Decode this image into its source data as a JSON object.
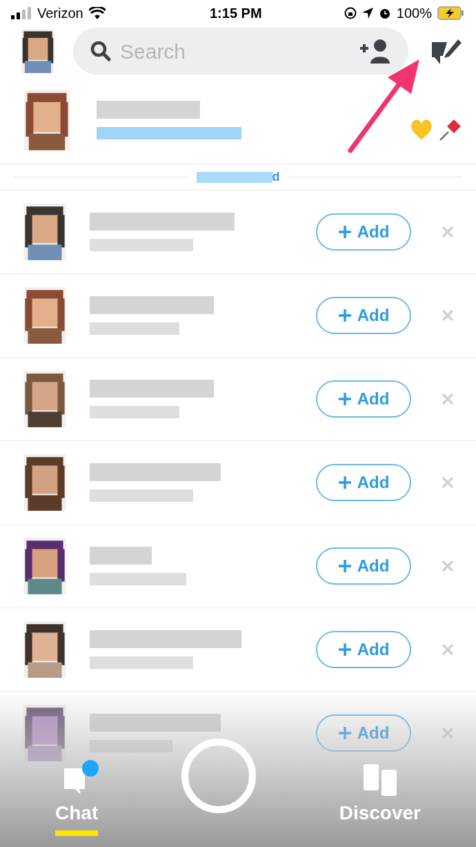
{
  "status_bar": {
    "carrier": "Verizon",
    "time": "1:15 PM",
    "battery": "100%"
  },
  "search": {
    "placeholder": "Search"
  },
  "pinned_chat": {
    "pinned": true,
    "favorite": true
  },
  "section": {
    "label": "d"
  },
  "suggestions": [
    {
      "add_label": "Add"
    },
    {
      "add_label": "Add"
    },
    {
      "add_label": "Add"
    },
    {
      "add_label": "Add"
    },
    {
      "add_label": "Add"
    },
    {
      "add_label": "Add"
    },
    {
      "add_label": "Add"
    }
  ],
  "nav": [
    {
      "label": "Chat",
      "selected": true,
      "unread": true
    },
    {
      "label": "Discover",
      "selected": false,
      "unread": false
    }
  ]
}
